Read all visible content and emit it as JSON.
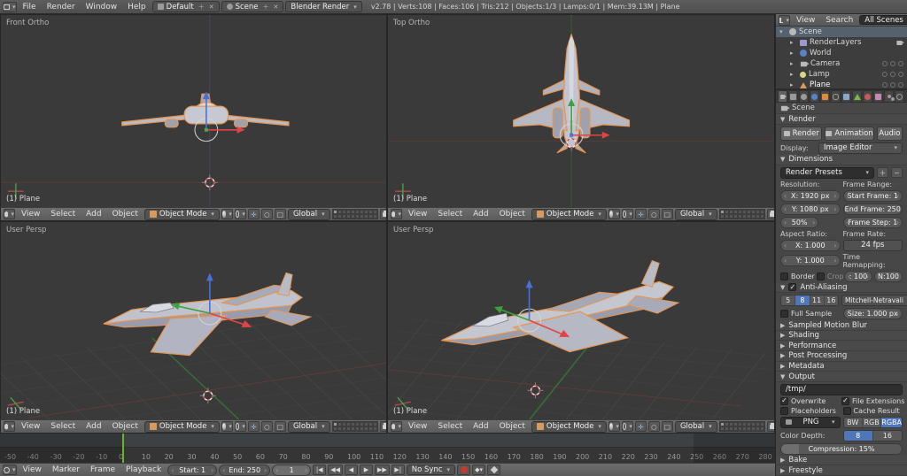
{
  "topbar": {
    "menus": [
      "File",
      "Render",
      "Window",
      "Help"
    ],
    "layout": "Default",
    "scene": "Scene",
    "engine": "Blender Render",
    "stats": "v2.78 | Verts:108 | Faces:106 | Tris:212 | Objects:1/3 | Lamps:0/1 | Mem:39.13M | Plane"
  },
  "viewport": {
    "menus": [
      "View",
      "Select",
      "Add",
      "Object"
    ],
    "mode": "Object Mode",
    "orientation": "Global",
    "views": [
      {
        "label": "Front Ortho",
        "object": "(1) Plane"
      },
      {
        "label": "Top Ortho",
        "object": "(1) Plane"
      },
      {
        "label": "User Persp",
        "object": "(1) Plane"
      },
      {
        "label": "User Persp",
        "object": "(1) Plane"
      }
    ]
  },
  "outliner": {
    "header": {
      "view": "View",
      "search": "Search",
      "scope": "All Scenes"
    },
    "items": [
      "Scene",
      "RenderLayers",
      "World",
      "Camera",
      "Lamp",
      "Plane"
    ]
  },
  "properties": {
    "context": "Scene",
    "render": {
      "title": "Render",
      "buttons": [
        "Render",
        "Animation",
        "Audio"
      ],
      "display_label": "Display:",
      "display_value": "Image Editor"
    },
    "dimensions": {
      "title": "Dimensions",
      "presets": "Render Presets",
      "resolution_label": "Resolution:",
      "res_x": "X: 1920 px",
      "res_y": "Y: 1080 px",
      "res_pct": "50%",
      "frame_range_label": "Frame Range:",
      "start_frame": "Start Frame: 1",
      "end_frame": "End Frame: 250",
      "frame_step": "Frame Step: 1",
      "aspect_label": "Aspect Ratio:",
      "aspect_x": "X: 1.000",
      "aspect_y": "Y: 1.000",
      "border": "Border",
      "crop": "Crop",
      "framerate_label": "Frame Rate:",
      "fps": "24 fps",
      "time_remap_label": "Time Remapping:",
      "remap_old": ": 100",
      "remap_new": "N:100"
    },
    "antialiasing": {
      "title": "Anti-Aliasing",
      "samples": [
        "5",
        "8",
        "11",
        "16"
      ],
      "filter": "Mitchell-Netravali",
      "full_sample": "Full Sample",
      "size": "Size: 1.000 px"
    },
    "collapsed": [
      "Sampled Motion Blur",
      "Shading",
      "Performance",
      "Post Processing",
      "Metadata"
    ],
    "output": {
      "title": "Output",
      "path": "/tmp/",
      "overwrite": "Overwrite",
      "file_extensions": "File Extensions",
      "placeholders": "Placeholders",
      "cache_result": "Cache Result",
      "format": "PNG",
      "channels": [
        "BW",
        "RGB",
        "RGBA"
      ],
      "color_depth_label": "Color Depth:",
      "depths": [
        "8",
        "16"
      ],
      "compression": "Compression: 15%"
    },
    "collapsed_bottom": [
      "Bake",
      "Freestyle"
    ]
  },
  "timeline": {
    "menus": [
      "View",
      "Marker",
      "Frame",
      "Playback"
    ],
    "start": "Start: 1",
    "end": "End: 250",
    "current": "1",
    "sync": "No Sync",
    "transport": [
      "|◀",
      "◀◀",
      "◀",
      "▶",
      "▶▶",
      "▶|"
    ],
    "ruler": [
      "-50",
      "-40",
      "-30",
      "-20",
      "-10",
      "0",
      "10",
      "20",
      "30",
      "40",
      "50",
      "60",
      "70",
      "80",
      "90",
      "100",
      "110",
      "120",
      "130",
      "140",
      "150",
      "160",
      "170",
      "180",
      "190",
      "200",
      "210",
      "220",
      "230",
      "240",
      "250",
      "260",
      "270",
      "280"
    ]
  }
}
